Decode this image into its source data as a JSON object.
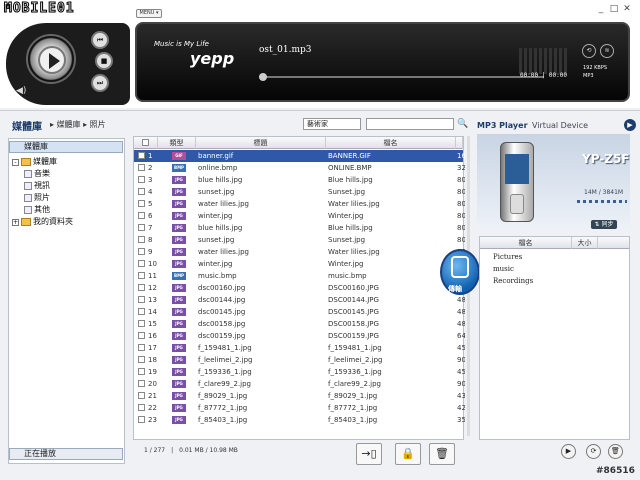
{
  "app": {
    "logo": "MOBILE01",
    "menu_label": "MENU ▾"
  },
  "window": {
    "minimize": "_",
    "maximize": "□",
    "close": "✕"
  },
  "player": {
    "tagline": "Music is My Life",
    "brand": "yepp",
    "song": "ost_01.mp3",
    "time": "00:00 | 00:00",
    "bitrate": "192 KBPS",
    "format": "MP3",
    "progress": 0
  },
  "nav": {
    "title": "媒體庫",
    "breadcrumb1": "媒體庫",
    "breadcrumb2": "照片",
    "selected": "媒體庫",
    "tree": [
      {
        "label": "媒體庫",
        "level": 0,
        "toggle": "-"
      },
      {
        "label": "音樂",
        "level": 1
      },
      {
        "label": "視訊",
        "level": 1
      },
      {
        "label": "照片",
        "level": 1
      },
      {
        "label": "其他",
        "level": 1
      },
      {
        "label": "我的資料夾",
        "level": 0,
        "toggle": "+"
      }
    ],
    "now_playing": "正在播放"
  },
  "search": {
    "field": "藝術家",
    "query": ""
  },
  "table": {
    "headers": [
      "類型",
      "標題",
      "檔名",
      ""
    ],
    "rows": [
      {
        "n": "1",
        "type": "GIF",
        "title": "banner.gif",
        "file": "BANNER.GIF",
        "size": "16"
      },
      {
        "n": "2",
        "type": "BMP",
        "title": "online.bmp",
        "file": "ONLINE.BMP",
        "size": "32"
      },
      {
        "n": "3",
        "type": "JPG",
        "title": "blue hills.jpg",
        "file": "Blue hills.jpg",
        "size": "80"
      },
      {
        "n": "4",
        "type": "JPG",
        "title": "sunset.jpg",
        "file": "Sunset.jpg",
        "size": "80"
      },
      {
        "n": "5",
        "type": "JPG",
        "title": "water lilies.jpg",
        "file": "Water lilies.jpg",
        "size": "80"
      },
      {
        "n": "6",
        "type": "JPG",
        "title": "winter.jpg",
        "file": "Winter.jpg",
        "size": "80"
      },
      {
        "n": "7",
        "type": "JPG",
        "title": "blue hills.jpg",
        "file": "Blue hills.jpg",
        "size": "80"
      },
      {
        "n": "8",
        "type": "JPG",
        "title": "sunset.jpg",
        "file": "Sunset.jpg",
        "size": "80"
      },
      {
        "n": "9",
        "type": "JPG",
        "title": "water lilies.jpg",
        "file": "Water lilies.jpg",
        "size": "80"
      },
      {
        "n": "10",
        "type": "JPG",
        "title": "winter.jpg",
        "file": "Winter.jpg",
        "size": "80"
      },
      {
        "n": "11",
        "type": "BMP",
        "title": "music.bmp",
        "file": "music.bmp",
        "size": "80"
      },
      {
        "n": "12",
        "type": "JPG",
        "title": "dsc00160.jpg",
        "file": "DSC00160.JPG",
        "size": "48"
      },
      {
        "n": "13",
        "type": "JPG",
        "title": "dsc00144.jpg",
        "file": "DSC00144.JPG",
        "size": "48"
      },
      {
        "n": "14",
        "type": "JPG",
        "title": "dsc00145.jpg",
        "file": "DSC00145.JPG",
        "size": "48"
      },
      {
        "n": "15",
        "type": "JPG",
        "title": "dsc00158.jpg",
        "file": "DSC00158.JPG",
        "size": "48"
      },
      {
        "n": "16",
        "type": "JPG",
        "title": "dsc00159.jpg",
        "file": "DSC00159.JPG",
        "size": "64"
      },
      {
        "n": "17",
        "type": "JPG",
        "title": "f_159481_1.jpg",
        "file": "f_159481_1.jpg",
        "size": "45"
      },
      {
        "n": "18",
        "type": "JPG",
        "title": "f_leelimei_2.jpg",
        "file": "f_leelimei_2.jpg",
        "size": "90"
      },
      {
        "n": "19",
        "type": "JPG",
        "title": "f_159336_1.jpg",
        "file": "f_159336_1.jpg",
        "size": "45"
      },
      {
        "n": "20",
        "type": "JPG",
        "title": "f_clare99_2.jpg",
        "file": "f_clare99_2.jpg",
        "size": "90"
      },
      {
        "n": "21",
        "type": "JPG",
        "title": "f_89029_1.jpg",
        "file": "f_89029_1.jpg",
        "size": "43"
      },
      {
        "n": "22",
        "type": "JPG",
        "title": "f_87772_1.jpg",
        "file": "f_87772_1.jpg",
        "size": "42"
      },
      {
        "n": "23",
        "type": "JPG",
        "title": "f_85403_1.jpg",
        "file": "f_85403_1.jpg",
        "size": "35"
      }
    ]
  },
  "status": "1 / 277　|　0.01 MB / 10.98 MB",
  "transfer_label": "傳輸",
  "right": {
    "tab1": "MP3 Player",
    "tab2": "Virtual Device",
    "device_name": "YP-Z5F",
    "capacity": "14M / 3841M",
    "sync_label": "同步",
    "headers": [
      "檔名",
      "大小"
    ],
    "items": [
      "Pictures",
      "music",
      "Recordings"
    ]
  },
  "watermark": "#86516",
  "colors": {
    "accent": "#2f58a8",
    "title": "#1d3d6d"
  }
}
